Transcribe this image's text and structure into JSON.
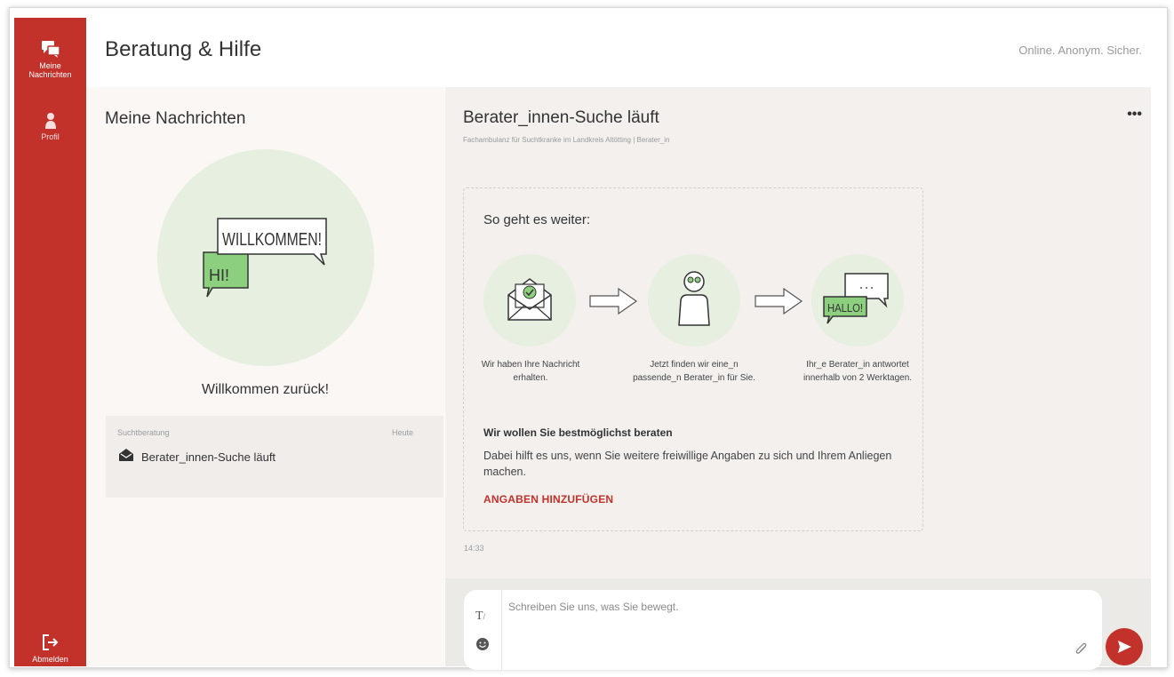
{
  "app": {
    "title": "Beratung & Hilfe",
    "tagline": "Online. Anonym. Sicher."
  },
  "sidebar": {
    "items": [
      {
        "label": "Meine Nachrichten",
        "icon": "chat-bubbles-icon",
        "active": true
      },
      {
        "label": "Profil",
        "icon": "person-icon",
        "active": false
      }
    ],
    "logout_label": "Abmelden"
  },
  "list": {
    "title": "Meine Nachrichten",
    "welcome_text": "Willkommen zurück!",
    "welcome_bubble_big": "WILLKOMMEN!",
    "welcome_bubble_small": "HI!",
    "items": [
      {
        "topic": "Suchtberatung",
        "date": "Heute",
        "subject": "Berater_innen-Suche läuft",
        "icon": "open-envelope-icon"
      }
    ]
  },
  "chat": {
    "title": "Berater_innen-Suche läuft",
    "subtitle": "Fachambulanz für Suchtkranke im Landkreis Altötting  |  Berater_in",
    "more_label": "•••",
    "card": {
      "heading": "So geht es weiter:",
      "steps": [
        {
          "text": "Wir haben Ihre Nachricht erhalten.",
          "icon": "envelope-check-icon"
        },
        {
          "text": "Jetzt finden wir eine_n passende_n Berater_in für Sie.",
          "icon": "person-search-icon"
        },
        {
          "text": "Ihr_e Berater_in antwortet innerhalb von 2 Werktagen.",
          "icon": "hallo-bubble-icon"
        }
      ],
      "hallo_text": "HALLO!",
      "bold_text": "Wir wollen Sie bestmöglichst beraten",
      "body_text": "Dabei hilft es uns, wenn Sie weitere freiwillige Angaben zu sich und Ihrem Anliegen machen.",
      "link_label": "ANGABEN HINZUFÜGEN"
    },
    "time": "14:33"
  },
  "composer": {
    "placeholder": "Schreiben Sie uns, was Sie bewegt.",
    "format_label": "T"
  },
  "colors": {
    "brand_red": "#c2312a",
    "mint": "#e6efe0",
    "green_bubble": "#8ccf7e"
  }
}
